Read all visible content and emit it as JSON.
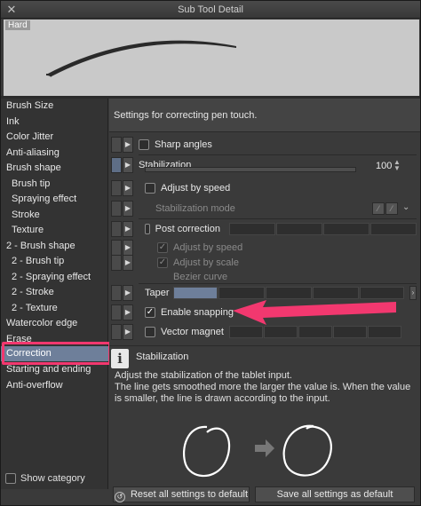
{
  "window": {
    "title": "Sub Tool Detail"
  },
  "preview": {
    "label": "Hard"
  },
  "sidebar": {
    "items": [
      {
        "label": "Brush Size"
      },
      {
        "label": "Ink"
      },
      {
        "label": "Color Jitter"
      },
      {
        "label": "Anti-aliasing"
      },
      {
        "label": "Brush shape"
      },
      {
        "label": "Brush tip"
      },
      {
        "label": "Spraying effect"
      },
      {
        "label": "Stroke"
      },
      {
        "label": "Texture"
      },
      {
        "label": "2 - Brush shape"
      },
      {
        "label": "2 - Brush tip"
      },
      {
        "label": "2 - Spraying effect"
      },
      {
        "label": "2 - Stroke"
      },
      {
        "label": "2 - Texture"
      },
      {
        "label": "Watercolor edge"
      },
      {
        "label": "Erase"
      },
      {
        "label": "Correction"
      },
      {
        "label": "Starting and ending"
      },
      {
        "label": "Anti-overflow"
      }
    ],
    "show_category": "Show category"
  },
  "panel": {
    "description": "Settings for correcting pen touch.",
    "sharp_angles": "Sharp angles",
    "stabilization": {
      "label": "Stabilization",
      "value": "100"
    },
    "adjust_by_speed": "Adjust by speed",
    "stabilization_mode": "Stabilization mode",
    "post_correction": "Post correction",
    "post_adjust_by_speed": "Adjust by speed",
    "post_adjust_by_scale": "Adjust by scale",
    "bezier_curve": "Bezier curve",
    "taper": "Taper",
    "enable_snapping": "Enable snapping",
    "vector_magnet": "Vector magnet"
  },
  "info": {
    "title": "Stabilization",
    "line1": "Adjust the stabilization of the tablet input.",
    "line2": "The line gets smoothed more the larger the value is. When the value is smaller, the line is drawn according to the input."
  },
  "footer": {
    "reset": "Reset all settings to default",
    "save": "Save all settings as default"
  },
  "colors": {
    "highlight": "#f2386f",
    "selection": "#6e7f9a"
  }
}
